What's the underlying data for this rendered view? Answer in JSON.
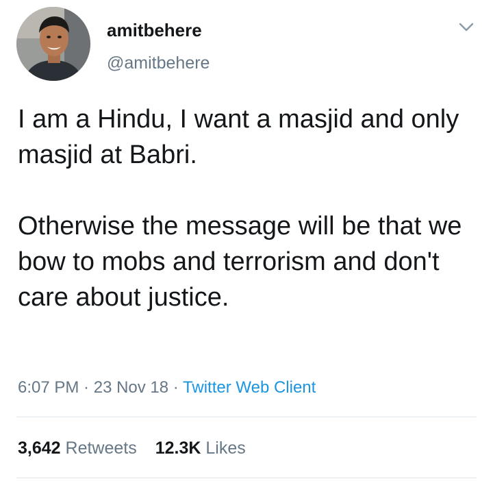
{
  "user": {
    "display_name": "amitbehere",
    "handle": "@amitbehere"
  },
  "tweet": {
    "paragraph_1": "I am a Hindu, I want a masjid and only masjid at Babri.",
    "paragraph_2": "Otherwise the message will be that we bow to mobs and terrorism and don't care about justice."
  },
  "meta": {
    "time": "6:07 PM",
    "date": "23 Nov 18",
    "separator": " · ",
    "client": "Twitter Web Client"
  },
  "stats": {
    "retweets_count": "3,642",
    "retweets_label": "Retweets",
    "likes_count": "12.3K",
    "likes_label": "Likes"
  },
  "icons": {
    "caret": "chevron-down-icon",
    "avatar": "profile-photo"
  },
  "colors": {
    "text_primary": "#14171a",
    "text_secondary": "#657786",
    "link": "#1b95e0",
    "divider": "#e1e8ed"
  }
}
